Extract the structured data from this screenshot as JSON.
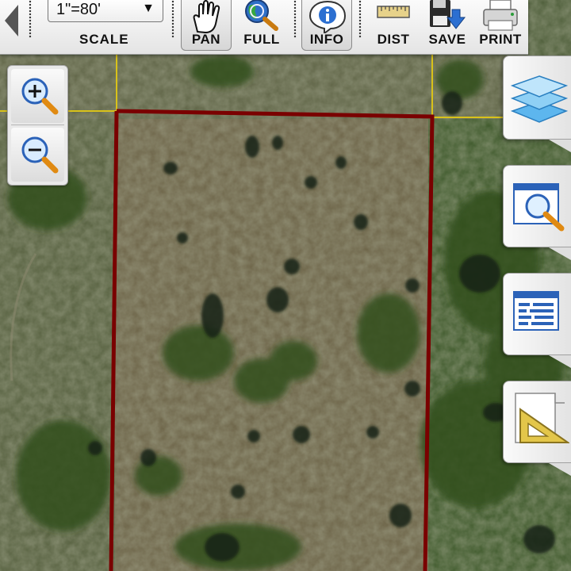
{
  "toolbar": {
    "scale": {
      "value": "1\"=80'",
      "label": "SCALE"
    },
    "tools": [
      {
        "id": "pan",
        "label": "PAN",
        "icon": "hand-icon"
      },
      {
        "id": "full",
        "label": "FULL",
        "icon": "globe-magnifier-icon"
      },
      {
        "id": "info",
        "label": "INFO",
        "icon": "info-icon"
      },
      {
        "id": "dist",
        "label": "DIST",
        "icon": "ruler-icon"
      },
      {
        "id": "save",
        "label": "SAVE",
        "icon": "floppy-icon"
      },
      {
        "id": "print",
        "label": "PRINT",
        "icon": "printer-icon"
      }
    ]
  },
  "zoom": [
    {
      "id": "zoom-in",
      "icon": "zoom-in-icon"
    },
    {
      "id": "zoom-out",
      "icon": "zoom-out-icon"
    }
  ],
  "side_tabs": [
    {
      "id": "layers",
      "icon": "layers-icon"
    },
    {
      "id": "search",
      "icon": "search-window-icon"
    },
    {
      "id": "details",
      "icon": "document-window-icon"
    },
    {
      "id": "measure",
      "icon": "set-square-icon"
    }
  ],
  "colors": {
    "parcel_outline": "#7a0000",
    "parcel_lines": "#d9c21a",
    "ground": "#6d6448",
    "vegetation": "#3e5a2a"
  }
}
